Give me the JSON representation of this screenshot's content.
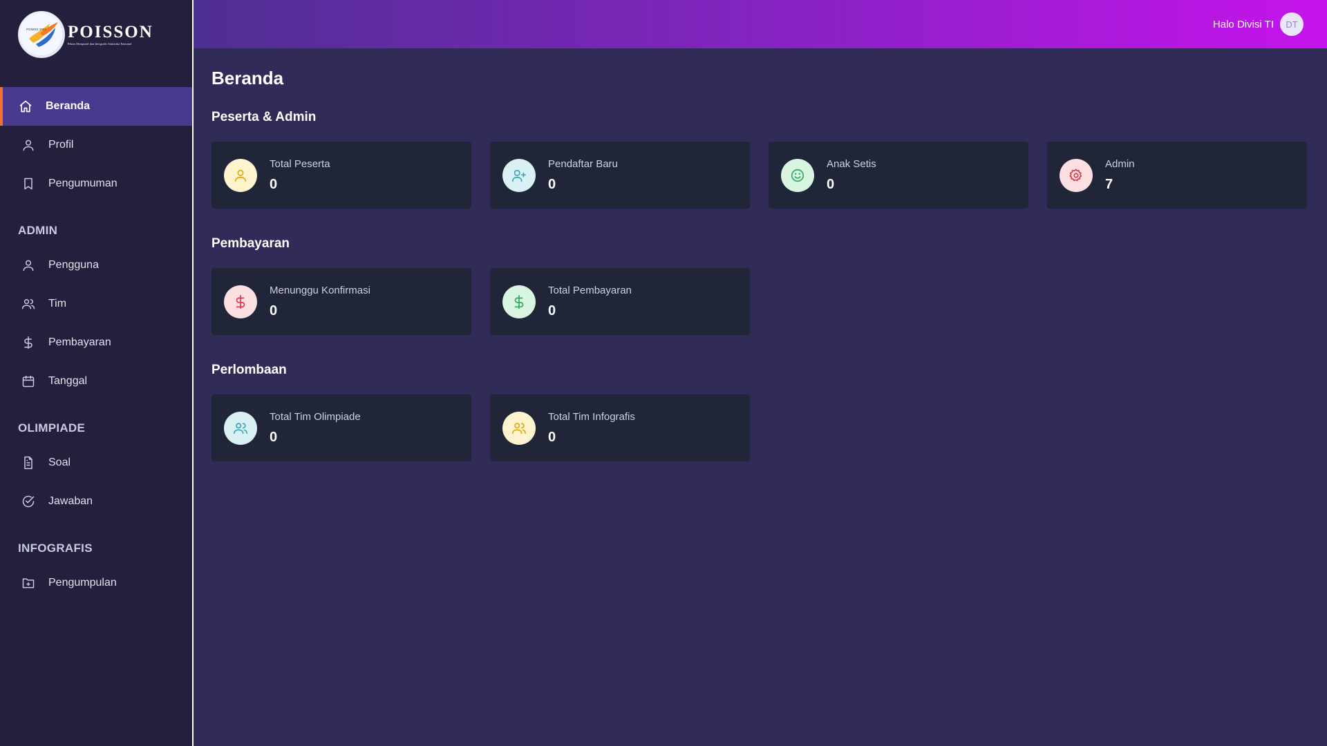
{
  "brand": {
    "badge_text": "POIMSS 2023",
    "title": "POISSON",
    "subtitle": "Pekan Olimpiade dan Infografis Statistika Nasional"
  },
  "sidebar": {
    "main_items": [
      {
        "label": "Beranda",
        "icon": "home-icon",
        "active": true
      },
      {
        "label": "Profil",
        "icon": "user-icon"
      },
      {
        "label": "Pengumuman",
        "icon": "bookmark-icon"
      }
    ],
    "sections": [
      {
        "label": "ADMIN",
        "items": [
          {
            "label": "Pengguna",
            "icon": "user-icon"
          },
          {
            "label": "Tim",
            "icon": "users-icon"
          },
          {
            "label": "Pembayaran",
            "icon": "dollar-icon"
          },
          {
            "label": "Tanggal",
            "icon": "calendar-icon"
          }
        ]
      },
      {
        "label": "OLIMPIADE",
        "items": [
          {
            "label": "Soal",
            "icon": "file-text-icon"
          },
          {
            "label": "Jawaban",
            "icon": "check-circle-icon"
          }
        ]
      },
      {
        "label": "INFOGRAFIS",
        "items": [
          {
            "label": "Pengumpulan",
            "icon": "folder-plus-icon"
          }
        ]
      }
    ]
  },
  "header": {
    "greeting": "Halo Divisi TI",
    "avatar_initials": "DT"
  },
  "main": {
    "page_title": "Beranda",
    "groups": [
      {
        "title": "Peserta & Admin",
        "cards": [
          {
            "label": "Total Peserta",
            "value": "0",
            "icon": "user-icon",
            "color": "#e0a800",
            "bg": "#fdf4cf"
          },
          {
            "label": "Pendaftar Baru",
            "value": "0",
            "icon": "user-plus-icon",
            "color": "#3aa3b5",
            "bg": "#d9f1f5"
          },
          {
            "label": "Anak Setis",
            "value": "0",
            "icon": "smile-icon",
            "color": "#27a85a",
            "bg": "#d8f5e2"
          },
          {
            "label": "Admin",
            "value": "7",
            "icon": "settings-icon",
            "color": "#dc3545",
            "bg": "#fbdfe2"
          }
        ]
      },
      {
        "title": "Pembayaran",
        "cards": [
          {
            "label": "Menunggu Konfirmasi",
            "value": "0",
            "icon": "dollar-icon",
            "color": "#dc3545",
            "bg": "#fbdfe2"
          },
          {
            "label": "Total Pembayaran",
            "value": "0",
            "icon": "dollar-icon",
            "color": "#27a85a",
            "bg": "#d8f5e2"
          }
        ]
      },
      {
        "title": "Perlombaan",
        "cards": [
          {
            "label": "Total Tim Olimpiade",
            "value": "0",
            "icon": "users-icon",
            "color": "#3aa3b5",
            "bg": "#d9f1f5"
          },
          {
            "label": "Total Tim Infografis",
            "value": "0",
            "icon": "users-icon",
            "color": "#e0a800",
            "bg": "#fdf4cf"
          }
        ]
      }
    ]
  }
}
